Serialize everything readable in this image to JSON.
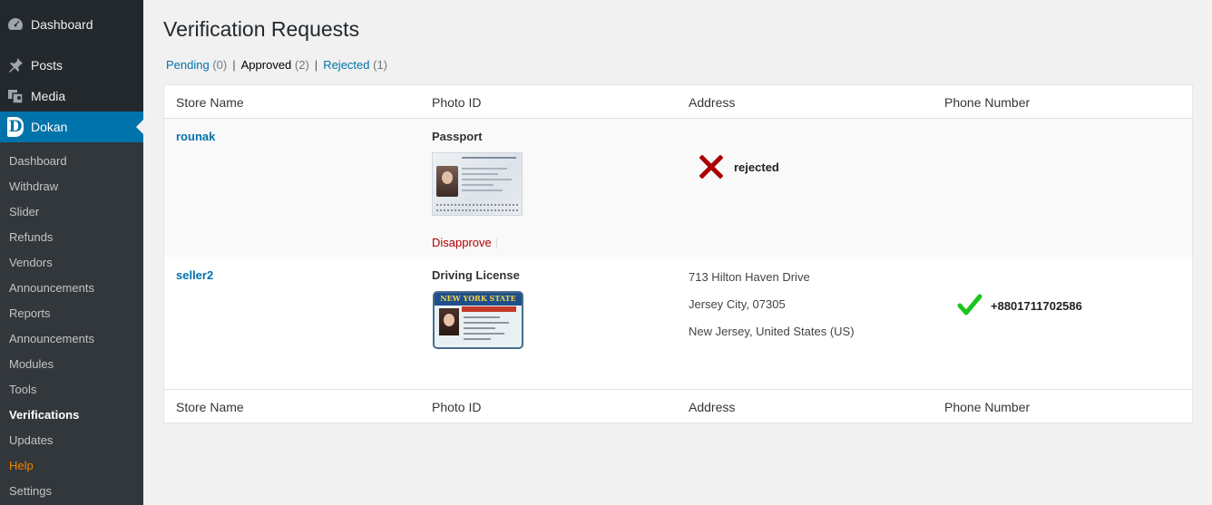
{
  "sidebar": {
    "top_items": [
      {
        "label": "Dashboard",
        "icon": "dashboard-icon"
      },
      {
        "label": "Posts",
        "icon": "pin-icon"
      },
      {
        "label": "Media",
        "icon": "media-icon"
      },
      {
        "label": "Dokan",
        "icon": "dokan-logo-icon"
      }
    ],
    "submenu": [
      "Dashboard",
      "Withdraw",
      "Slider",
      "Refunds",
      "Vendors",
      "Announcements",
      "Reports",
      "Announcements",
      "Modules",
      "Tools",
      "Verifications",
      "Updates",
      "Help",
      "Settings"
    ],
    "current": "Verifications",
    "colors": {
      "bg": "#23282d",
      "active": "#0073aa",
      "help": "#f18500"
    }
  },
  "page": {
    "title": "Verification Requests",
    "filters": [
      {
        "label": "Pending",
        "count": "(0)"
      },
      {
        "label": "Approved",
        "count": "(2)"
      },
      {
        "label": "Rejected",
        "count": "(1)"
      }
    ],
    "filter_sep": "|"
  },
  "table": {
    "columns": [
      "Store Name",
      "Photo ID",
      "Address",
      "Phone Number"
    ],
    "rows": [
      {
        "store": "rounak",
        "doc_type": "Passport",
        "action": "Disapprove",
        "action_sep": "|",
        "status_icon": "rejected-x-icon",
        "status": "rejected"
      },
      {
        "store": "seller2",
        "doc_type": "Driving License",
        "doc_header": "NEW YORK STATE",
        "address": [
          "713 Hilton Haven Drive",
          "Jersey City, 07305",
          "New Jersey, United States (US)"
        ],
        "status_icon": "approved-check-icon",
        "phone": "+8801711702586"
      }
    ]
  }
}
